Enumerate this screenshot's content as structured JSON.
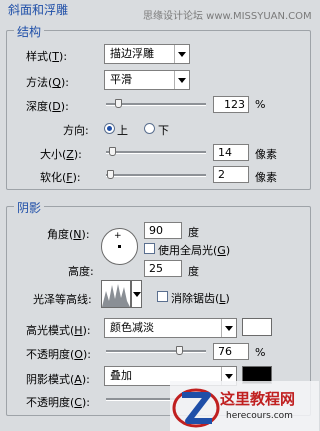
{
  "header": {
    "title": "斜面和浮雕",
    "watermark": "思缘设计论坛 www.MISSYUAN.COM"
  },
  "structure": {
    "title": "结构",
    "style": {
      "label": "样式",
      "key": "T",
      "value": "描边浮雕"
    },
    "technique": {
      "label": "方法",
      "key": "Q",
      "value": "平滑"
    },
    "depth": {
      "label": "深度",
      "key": "D",
      "value": "123",
      "unit": "%",
      "level": 0.12
    },
    "direction": {
      "label": "方向:",
      "up": "上",
      "down": "下",
      "selected": "up"
    },
    "size": {
      "label": "大小",
      "key": "Z",
      "value": "14",
      "unit": "像素",
      "level": 0.05
    },
    "soften": {
      "label": "软化",
      "key": "F",
      "value": "2",
      "unit": "像素",
      "level": 0.02
    }
  },
  "shading": {
    "title": "阴影",
    "angle": {
      "label": "角度",
      "key": "N",
      "value": "90",
      "unit": "度",
      "global_light_label": "使用全局光",
      "global_light_key": "G",
      "global_light_checked": false
    },
    "altitude": {
      "label": "高度:",
      "value": "25",
      "unit": "度"
    },
    "gloss_contour": {
      "label": "光泽等高线:",
      "anti_alias_label": "消除锯齿",
      "anti_alias_key": "L",
      "anti_alias_checked": false
    },
    "highlight_mode": {
      "label": "高光模式",
      "key": "H",
      "value": "颜色减淡",
      "color": "#ffffff"
    },
    "highlight_opacity": {
      "label": "不透明度",
      "key": "O",
      "value": "76",
      "unit": "%",
      "level": 0.76
    },
    "shadow_mode": {
      "label": "阴影模式",
      "key": "A",
      "value": "叠加",
      "color": "#000000"
    },
    "shadow_opacity": {
      "label": "不透明度",
      "key": "C"
    }
  },
  "footer_logo": {
    "title": "这里教程网",
    "url": "herecours.com"
  }
}
